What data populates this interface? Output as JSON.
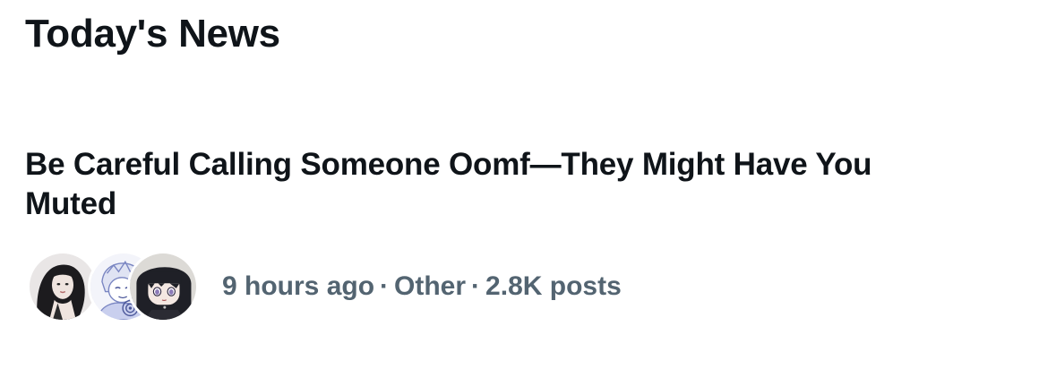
{
  "section": {
    "title": "Today's News"
  },
  "story": {
    "headline": "Be Careful Calling Someone Oomf—They Might Have You Muted",
    "time": "9 hours ago",
    "category": "Other",
    "post_count": "2.8K posts",
    "separator": "·",
    "avatars": [
      {
        "icon": "user-avatar-photo"
      },
      {
        "icon": "user-avatar-drawing"
      },
      {
        "icon": "user-avatar-anime"
      }
    ]
  },
  "colors": {
    "text_primary": "#0f1419",
    "text_secondary": "#536471",
    "background": "#ffffff"
  }
}
